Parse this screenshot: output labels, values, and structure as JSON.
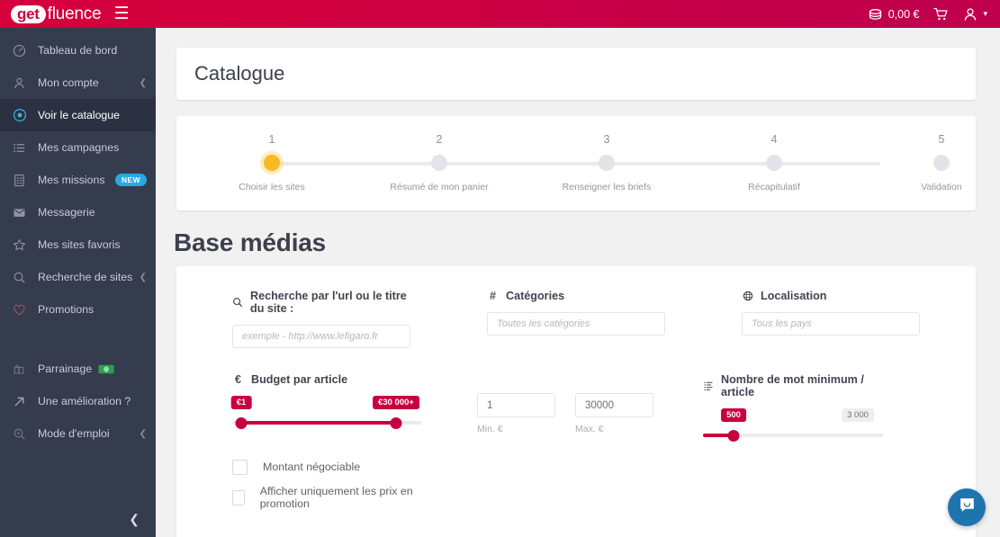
{
  "header": {
    "brand_get": "get",
    "brand_fluence": "fluence",
    "menu_icon": "hamburger-icon",
    "balance": "0,00 €",
    "cart_icon": "cart-icon",
    "account_icon": "user-icon"
  },
  "sidebar": {
    "items": [
      {
        "label": "Tableau de bord",
        "icon": "dashboard-icon",
        "active": false,
        "chevron": false,
        "badge": null
      },
      {
        "label": "Mon compte",
        "icon": "user-icon",
        "active": false,
        "chevron": true,
        "badge": null
      },
      {
        "label": "Voir le catalogue",
        "icon": "target-icon",
        "active": true,
        "chevron": false,
        "badge": null
      },
      {
        "label": "Mes campagnes",
        "icon": "list-icon",
        "active": false,
        "chevron": false,
        "badge": null
      },
      {
        "label": "Mes missions",
        "icon": "clipboard-icon",
        "active": false,
        "chevron": false,
        "badge": "NEW"
      },
      {
        "label": "Messagerie",
        "icon": "envelope-icon",
        "active": false,
        "chevron": false,
        "badge": null
      },
      {
        "label": "Mes sites favoris",
        "icon": "star-icon",
        "active": false,
        "chevron": false,
        "badge": null
      },
      {
        "label": "Recherche de sites",
        "icon": "search-icon",
        "active": false,
        "chevron": true,
        "badge": null
      },
      {
        "label": "Promotions",
        "icon": "heart-icon",
        "active": false,
        "chevron": false,
        "badge": null
      }
    ],
    "items_bottom": [
      {
        "label": "Parrainage",
        "icon": "gift-icon",
        "money": true,
        "chevron": false
      },
      {
        "label": "Une amélioration ?",
        "icon": "arrow-up-right-icon",
        "money": false,
        "chevron": false
      },
      {
        "label": "Mode d'emploi",
        "icon": "search-doc-icon",
        "money": false,
        "chevron": true
      }
    ],
    "collapse_icon": "chevron-left-icon"
  },
  "page": {
    "card_title": "Catalogue",
    "heading": "Base médias"
  },
  "stepper": {
    "steps": [
      {
        "num": "1",
        "label": "Choisir les sites",
        "current": true
      },
      {
        "num": "2",
        "label": "Résumé de mon panier",
        "current": false
      },
      {
        "num": "3",
        "label": "Renseigner les briefs",
        "current": false
      },
      {
        "num": "4",
        "label": "Récapitulatif",
        "current": false
      },
      {
        "num": "5",
        "label": "Validation",
        "current": false
      }
    ]
  },
  "filters": {
    "search": {
      "label": "Recherche par l'url ou le titre du site :",
      "icon": "search-icon",
      "placeholder": "exemple - http://www.lefigaro.fr",
      "value": ""
    },
    "categories": {
      "label": "Catégories",
      "icon": "hash-icon",
      "placeholder": "Toutes les catégories",
      "value": ""
    },
    "localisation": {
      "label": "Localisation",
      "icon": "globe-icon",
      "placeholder": "Tous les pays",
      "value": ""
    },
    "budget": {
      "label": "Budget par article",
      "icon": "euro-icon",
      "min_bubble": "€1",
      "max_bubble": "€30 000+",
      "min_percent": 0,
      "max_percent": 100
    },
    "min_field": {
      "value": "1",
      "label": "Min. €"
    },
    "max_field": {
      "value": "30000",
      "label": "Max. €"
    },
    "words": {
      "label": "Nombre de mot minimum / article",
      "icon": "text-lines-icon",
      "value_bubble": "500",
      "max_bubble": "3 000",
      "percent": 17
    },
    "checkboxes": [
      {
        "label": "Montant négociable",
        "checked": false
      },
      {
        "label": "Afficher uniquement les prix en promotion",
        "checked": false
      }
    ]
  },
  "support": {
    "chat_icon": "chat-bubble-icon"
  },
  "colors": {
    "brand_crimson": "#c9003f",
    "header_gradient_start": "#d6003c",
    "sidebar_bg": "#353c4e",
    "sidebar_active": "#2b3141",
    "step_current": "#f7b924",
    "badge_new": "#2aa8e0",
    "intercom": "#1f74ad"
  }
}
